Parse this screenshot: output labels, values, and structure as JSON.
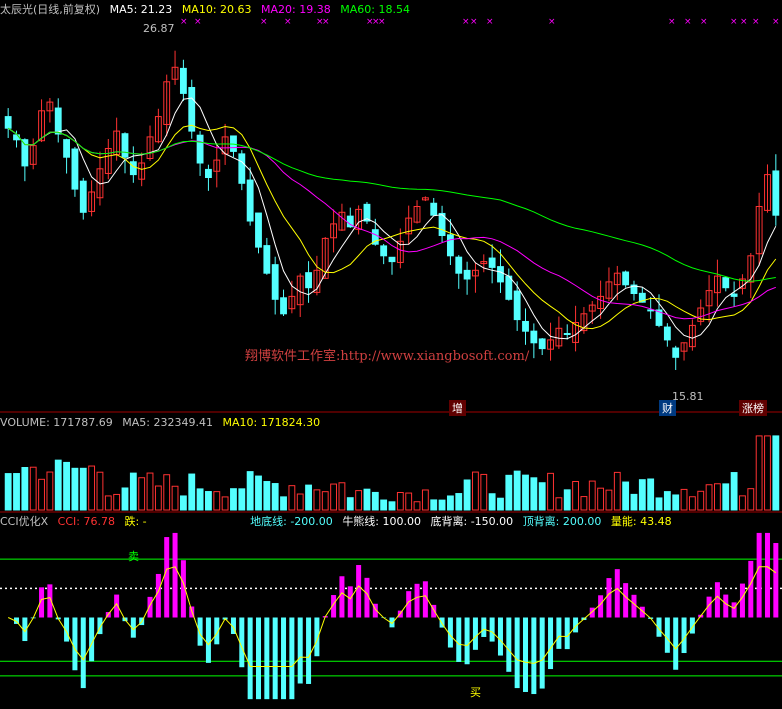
{
  "price_panel": {
    "title": "太辰光(日线,前复权)",
    "ma5": "MA5: 21.23",
    "ma10": "MA10: 20.63",
    "ma20": "MA20: 19.38",
    "ma60": "MA60: 18.54",
    "high_label": "26.87",
    "low_label": "15.81",
    "badge_zeng": "增",
    "badge_cai": "财",
    "badge_zhangbang": "涨榜",
    "watermark": "翔博软件工作室:http://www.xiangbosoft.com/"
  },
  "volume_panel": {
    "volume": "VOLUME: 171787.69",
    "ma5": "MA5: 232349.41",
    "ma10": "MA10: 171824.30"
  },
  "cci_panel": {
    "name": "CCI优化X",
    "cci": "CCI: 76.78",
    "die": "跌: -",
    "didi": "地底线: -200.00",
    "niuxiong": "牛熊线: 100.00",
    "dibeili": "底背离: -150.00",
    "dingbeili": "顶背离: 200.00",
    "liangneng": "量能: 43.48",
    "buy_label": "买",
    "sell_label": "卖"
  },
  "colors": {
    "up": "#ff3232",
    "down": "#54ffff",
    "ma5": "#ffffff",
    "ma10": "#ffff00",
    "ma20": "#ff00ff",
    "ma60": "#00ff00",
    "magenta": "#ff00ff",
    "cyan": "#54ffff",
    "green": "#00ff00",
    "red": "#ff0000",
    "yellow": "#ffff00",
    "grid": "#a00000"
  },
  "chart_data": {
    "type": "candlestick",
    "price_range": [
      15.0,
      28.0
    ],
    "high": 26.87,
    "low": 15.81,
    "close": [
      24.2,
      23.8,
      22.9,
      23.6,
      24.8,
      25.1,
      24.0,
      23.2,
      22.1,
      21.3,
      22.0,
      22.8,
      23.5,
      24.1,
      23.2,
      22.6,
      23.0,
      23.9,
      24.6,
      25.8,
      26.3,
      25.4,
      24.1,
      23.0,
      22.5,
      23.1,
      23.9,
      23.4,
      22.3,
      21.0,
      20.1,
      19.2,
      18.3,
      17.8,
      18.4,
      19.1,
      18.7,
      19.3,
      20.4,
      20.9,
      21.3,
      20.8,
      21.4,
      21.0,
      20.2,
      19.8,
      19.6,
      20.3,
      21.1,
      21.5,
      21.8,
      21.2,
      20.5,
      19.8,
      19.2,
      19.0,
      19.3,
      19.6,
      19.4,
      18.9,
      18.3,
      17.6,
      17.2,
      16.8,
      16.6,
      16.9,
      17.3,
      17.1,
      17.5,
      17.8,
      18.1,
      18.4,
      18.9,
      19.2,
      18.8,
      18.5,
      18.2,
      17.9,
      17.4,
      16.9,
      16.3,
      16.8,
      17.4,
      18.0,
      18.6,
      19.1,
      18.7,
      18.4,
      19.0,
      19.8,
      21.5,
      22.6,
      21.2
    ]
  }
}
